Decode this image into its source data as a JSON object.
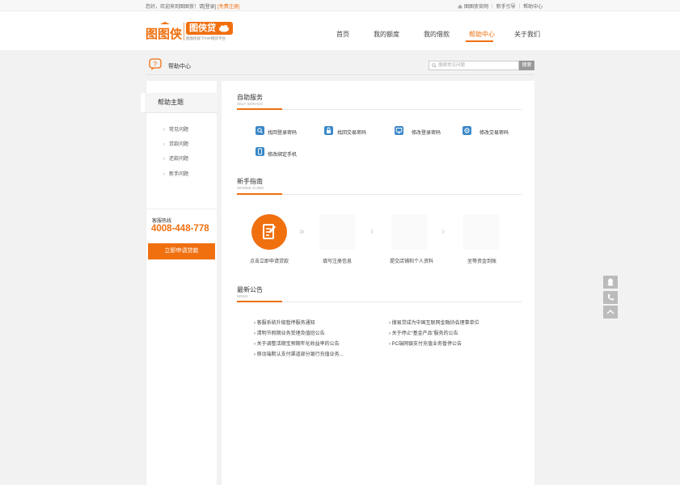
{
  "topbar": {
    "welcome": "您好，欢迎来到图图侠！请",
    "login": "[登录]",
    "register": "[免费注册]",
    "links": [
      "图图侠官网",
      "新手引导",
      "帮助中心"
    ]
  },
  "header": {
    "logo_main": "图图侠",
    "logo_product": "图侠贷",
    "logo_tagline": "图图侠旗下P2P网贷平台",
    "nav": [
      "首页",
      "我的额度",
      "我的借款",
      "帮助中心",
      "关于我们"
    ],
    "active_nav": "帮助中心"
  },
  "crumb": {
    "title": "帮助中心",
    "search_placeholder": "搜索常见问题",
    "search_button": "搜索"
  },
  "sidebar": {
    "heading": "帮助主题",
    "items": [
      "常见问题",
      "贷款问题",
      "还款问题",
      "新手问题"
    ],
    "hotline_label": "客服热线",
    "hotline_number": "4008-448-778",
    "apply_button": "立即申请贷款"
  },
  "self_service": {
    "title": "自助服务",
    "subtitle": "SELF SERVICE",
    "items": [
      {
        "label": "找回登录密码",
        "icon": "search-icon"
      },
      {
        "label": "找回交易密码",
        "icon": "lock-icon"
      },
      {
        "label": "修改登录密码",
        "icon": "monitor-icon"
      },
      {
        "label": "修改交易密码",
        "icon": "gear-icon"
      },
      {
        "label": "修改绑定手机",
        "icon": "phone-icon"
      }
    ]
  },
  "guide": {
    "title": "新手指南",
    "subtitle": "NEWBIE GUIDE",
    "steps": [
      "点击立即申请贷款",
      "填写注册信息",
      "提交店铺和个人资料",
      "坐等资金到账"
    ]
  },
  "news": {
    "title": "最新公告",
    "subtitle": "NEWS",
    "left": [
      "客服系统升级暂停服务通知",
      "清明节假期业务受理及值班公告",
      "关于调整活期宝预期年化收益率的公告",
      "移动端默认支付渠道部分银行充值业务..."
    ],
    "right": [
      "搜易贷成为中国互联网金融协会理事单位",
      "关于停止“基金产品”服务的公告",
      "PC端网银支付充值业务暂停公告"
    ]
  },
  "colors": {
    "accent": "#f07010",
    "bg": "#f2f2f2",
    "icon_blue": "#3a87c8"
  }
}
